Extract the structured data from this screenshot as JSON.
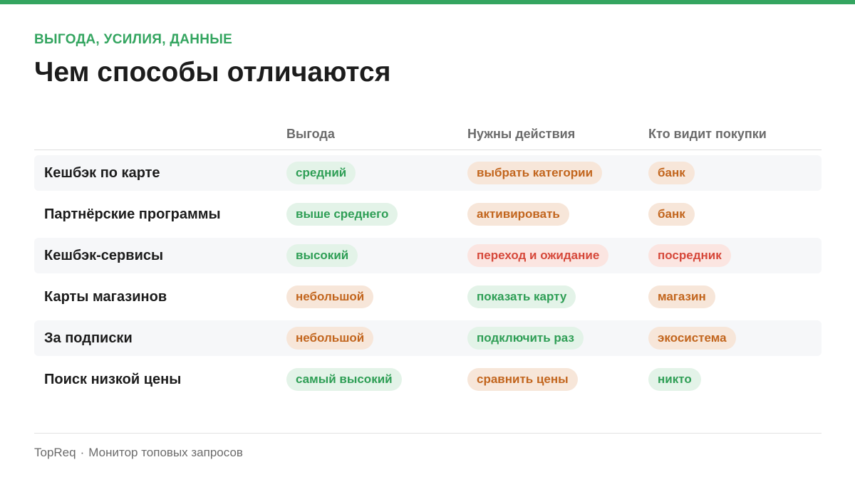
{
  "header": {
    "eyebrow": "ВЫГОДА, УСИЛИЯ, ДАННЫЕ",
    "title": "Чем способы отличаются"
  },
  "table": {
    "columns": [
      "Выгода",
      "Нужны действия",
      "Кто видит покупки"
    ],
    "rows": [
      {
        "label": "Кешбэк по карте",
        "cells": [
          {
            "text": "средний",
            "tone": "green"
          },
          {
            "text": "выбрать категории",
            "tone": "orange"
          },
          {
            "text": "банк",
            "tone": "orange"
          }
        ]
      },
      {
        "label": "Партнёрские программы",
        "cells": [
          {
            "text": "выше среднего",
            "tone": "green"
          },
          {
            "text": "активировать",
            "tone": "orange"
          },
          {
            "text": "банк",
            "tone": "orange"
          }
        ]
      },
      {
        "label": "Кешбэк-сервисы",
        "cells": [
          {
            "text": "высокий",
            "tone": "green"
          },
          {
            "text": "переход и ожидание",
            "tone": "red"
          },
          {
            "text": "посредник",
            "tone": "red"
          }
        ]
      },
      {
        "label": "Карты магазинов",
        "cells": [
          {
            "text": "небольшой",
            "tone": "orange"
          },
          {
            "text": "показать карту",
            "tone": "green"
          },
          {
            "text": "магазин",
            "tone": "orange"
          }
        ]
      },
      {
        "label": "За подписки",
        "cells": [
          {
            "text": "небольшой",
            "tone": "orange"
          },
          {
            "text": "подключить раз",
            "tone": "green"
          },
          {
            "text": "экосистема",
            "tone": "orange"
          }
        ]
      },
      {
        "label": "Поиск низкой цены",
        "cells": [
          {
            "text": "самый высокий",
            "tone": "green"
          },
          {
            "text": "сравнить цены",
            "tone": "orange"
          },
          {
            "text": "никто",
            "tone": "green"
          }
        ]
      }
    ]
  },
  "footer": {
    "brand": "TopReq",
    "separator": "·",
    "tagline": "Монитор топовых запросов"
  },
  "colors": {
    "accent": "#34a560",
    "green_pill_bg": "#e3f3e8",
    "green_pill_text": "#2e9e55",
    "orange_pill_bg": "#f7e6d9",
    "orange_pill_text": "#c2651d",
    "red_pill_bg": "#fbe5e1",
    "red_pill_text": "#d6483a"
  }
}
